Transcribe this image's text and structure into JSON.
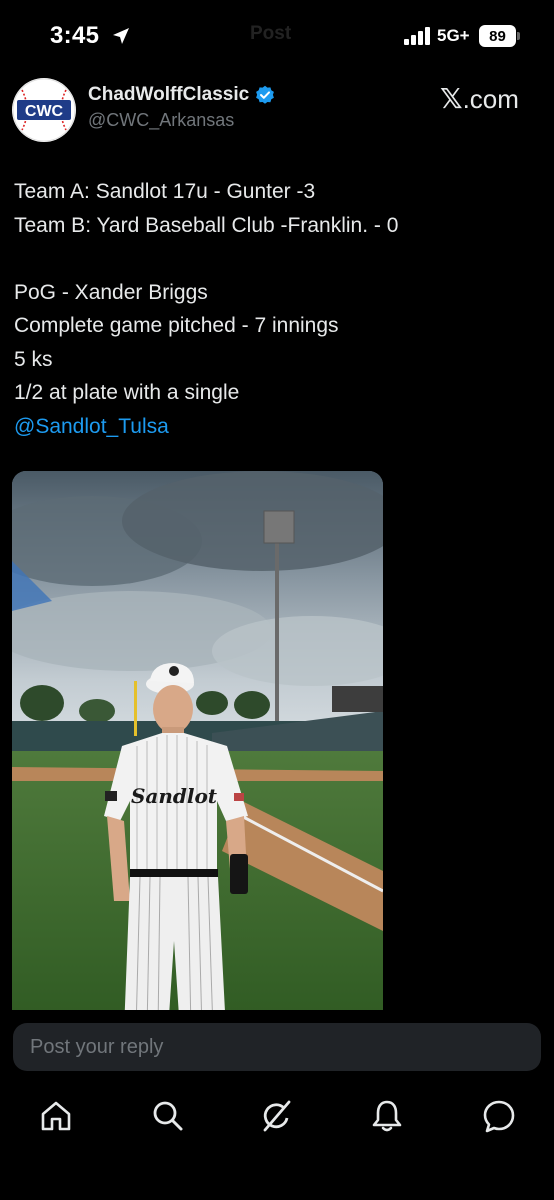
{
  "status_bar": {
    "time": "3:45",
    "faded_title": "Post",
    "network": "5G+",
    "battery": "89"
  },
  "header": {
    "display_name": "ChadWolffClassic",
    "handle": "@CWC_Arkansas",
    "site_label_x": "𝕏",
    "site_label_domain": ".com",
    "avatar_text": "CWC"
  },
  "post": {
    "line1": "Team A: Sandlot 17u - Gunter -3",
    "line2": "Team B: Yard Baseball Club -Franklin. - 0",
    "line3": "PoG - Xander Briggs",
    "line4": "Complete game pitched - 7 innings",
    "line5": "5 ks",
    "line6": "1/2 at plate with a single",
    "mention": "@Sandlot_Tulsa"
  },
  "media": {
    "jersey_text": "Sandlot"
  },
  "reply": {
    "placeholder": "Post your reply"
  },
  "tab_bar": {
    "items": [
      "home-icon",
      "search-icon",
      "grok-icon",
      "notifications-icon",
      "messages-icon"
    ]
  },
  "colors": {
    "background": "#000000",
    "text": "#e7e9ea",
    "muted": "#71767b",
    "accent": "#1d9bf0",
    "input_bg": "#202327"
  }
}
